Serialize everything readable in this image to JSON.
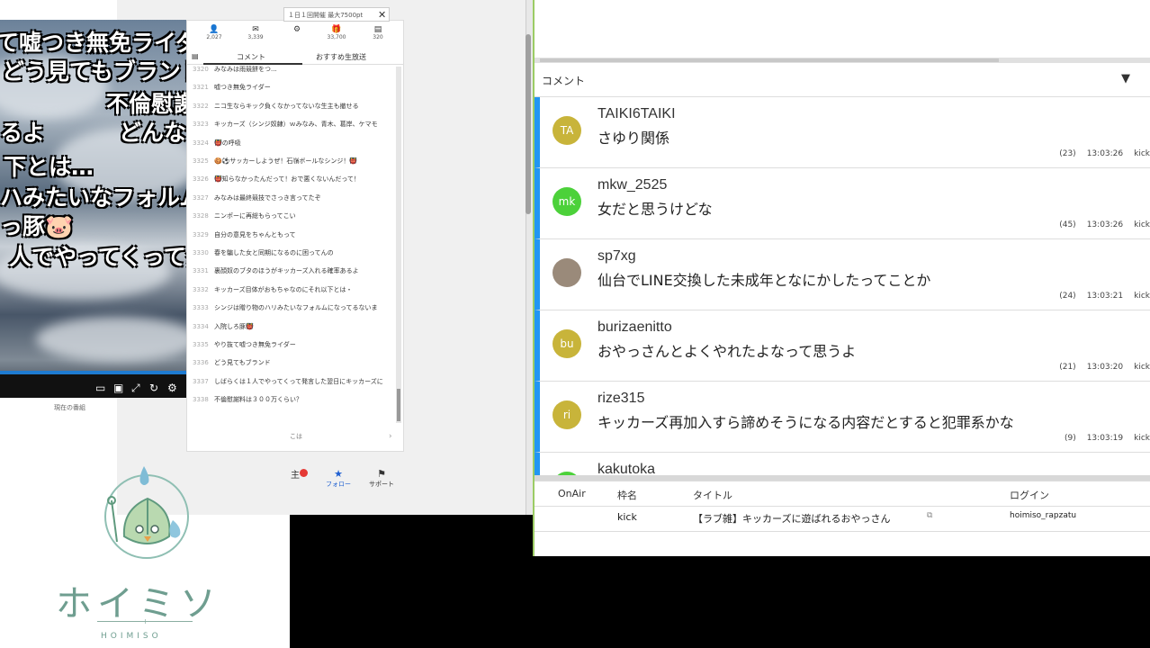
{
  "video": {
    "overlay_lines": [
      "て嘘つき無免ライダー",
      "どう見てもブランド",
      "不倫慰謝",
      "るよ",
      "どんな",
      "下とは…",
      "ハみたいなフォルム",
      "っ豚🐷",
      "人でやってくって発"
    ],
    "caption": "現在の番組"
  },
  "nico": {
    "banner": "１日１回開催 最大7500pt",
    "stats": [
      {
        "icon": "person",
        "value": "2,027"
      },
      {
        "icon": "comment",
        "value": "3,339"
      },
      {
        "icon": "settings",
        "value": ""
      },
      {
        "icon": "gift",
        "value": "33,700"
      },
      {
        "icon": "ad",
        "value": "320"
      }
    ],
    "tabs": [
      "コメント",
      "おすすめ生放送"
    ],
    "rows": [
      {
        "num": "3320",
        "text": "みなみは雨競餅をつ..."
      },
      {
        "num": "3321",
        "text": "嘘つき無免ライダー"
      },
      {
        "num": "3322",
        "text": "ニコ生ならキック負くなかってないな生主も撤せる"
      },
      {
        "num": "3323",
        "text": "キッカーズ（シンジ奴隷）ｗみなみ、青木、葛岸、ケマモ"
      },
      {
        "num": "3324",
        "text": "👹の呼吸"
      },
      {
        "num": "3325",
        "text": "🍪⚽サッカーしようぜ！石嶺ボールなシンジ！👹"
      },
      {
        "num": "3326",
        "text": "👹知らなかったんだって！おで悪くないんだって！"
      },
      {
        "num": "3327",
        "text": "みなみは最終競技でさっき言ってたぞ"
      },
      {
        "num": "3328",
        "text": "ニンポーに再総もらってこい"
      },
      {
        "num": "3329",
        "text": "自分の意見をちゃんともって"
      },
      {
        "num": "3330",
        "text": "春を騙した女と同期になるのに困ってんの"
      },
      {
        "num": "3331",
        "text": "裏顔奴のブタのほうがキッカーズ入れる確率あるよ"
      },
      {
        "num": "3332",
        "text": "キッカーズ目体がおもちゃなのにそれ以下とは・"
      },
      {
        "num": "3333",
        "text": "シンジは贈り物のハリみたいなフォルムになってるないま"
      },
      {
        "num": "3334",
        "text": "入院しろ豚👹"
      },
      {
        "num": "3335",
        "text": "やり抜て嘘つき無免ライダー"
      },
      {
        "num": "3336",
        "text": "どう見てもブランド"
      },
      {
        "num": "3337",
        "text": "しばらくは１人でやってくって発言した翌日にキッカーズに"
      },
      {
        "num": "3338",
        "text": "不倫慰謝料は３００万くらい？"
      }
    ],
    "input_placeholder": "こは",
    "buttons": [
      {
        "icon": "star",
        "label": "フォロー"
      },
      {
        "icon": "flag",
        "label": "サポート"
      }
    ],
    "bottom_fragment": "主"
  },
  "logo": {
    "title": "ホイミソ",
    "subtitle": "HOIMISO",
    "divider_glyph": "+"
  },
  "comments_app": {
    "header_title": "コメント",
    "items": [
      {
        "initials": "TA",
        "color": "#c8b43a",
        "user": "TAIKI6TAIKI",
        "text": "さゆり関係",
        "count": "(23)",
        "time": "13:03:26",
        "source": "kick"
      },
      {
        "initials": "mk",
        "color": "#4cd13a",
        "user": "mkw_2525",
        "text": "女だと思うけどな",
        "count": "(45)",
        "time": "13:03:26",
        "source": "kick"
      },
      {
        "initials": "",
        "color": "#9a8a7a",
        "user": "sp7xg",
        "text": "仙台でLINE交換した未成年となにかしたってことか",
        "count": "(24)",
        "time": "13:03:21",
        "source": "kick"
      },
      {
        "initials": "bu",
        "color": "#c8b43a",
        "user": "burizaenitto",
        "text": "おやっさんとよくやれたよなって思うよ",
        "count": "(21)",
        "time": "13:03:20",
        "source": "kick"
      },
      {
        "initials": "ri",
        "color": "#c8b43a",
        "user": "rize315",
        "text": "キッカーズ再加入すら諦めそうになる内容だとすると犯罪系かな",
        "count": "(9)",
        "time": "13:03:19",
        "source": "kick"
      },
      {
        "initials": "",
        "color": "#4cd13a",
        "user": "kakutoka",
        "text": "",
        "count": "",
        "time": "",
        "source": ""
      }
    ],
    "table": {
      "headers": [
        "OnAir",
        "枠名",
        "タイトル",
        "ログイン"
      ],
      "row": {
        "onair": "",
        "frame": "kick",
        "title": "【ラブ雑】キッカーズに遊ばれるおやっさん",
        "login": "hoimiso_rapzatu"
      }
    }
  }
}
